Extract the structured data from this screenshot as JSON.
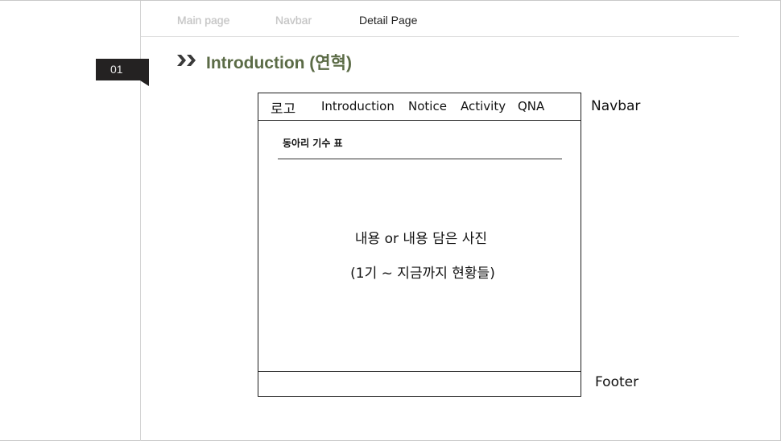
{
  "tabs": {
    "main": "Main page",
    "navbar": "Navbar",
    "detail": "Detail Page"
  },
  "section": {
    "badge": "01",
    "title": "Introduction (연혁)"
  },
  "wireframe": {
    "nav": {
      "logo": "로고",
      "items": [
        "Introduction",
        "Notice",
        "Activity",
        "QNA"
      ]
    },
    "subtitle": "동아리 기수 표",
    "content_line1": "내용 or 내용 담은 사진",
    "content_line2": "(1기 ~ 지금까지 현황들)"
  },
  "annotations": {
    "navbar": "Navbar",
    "footer": "Footer"
  },
  "colors": {
    "heading": "#5b6b46",
    "badge_bg": "#242222",
    "inactive_tab": "#c3c3c3"
  }
}
